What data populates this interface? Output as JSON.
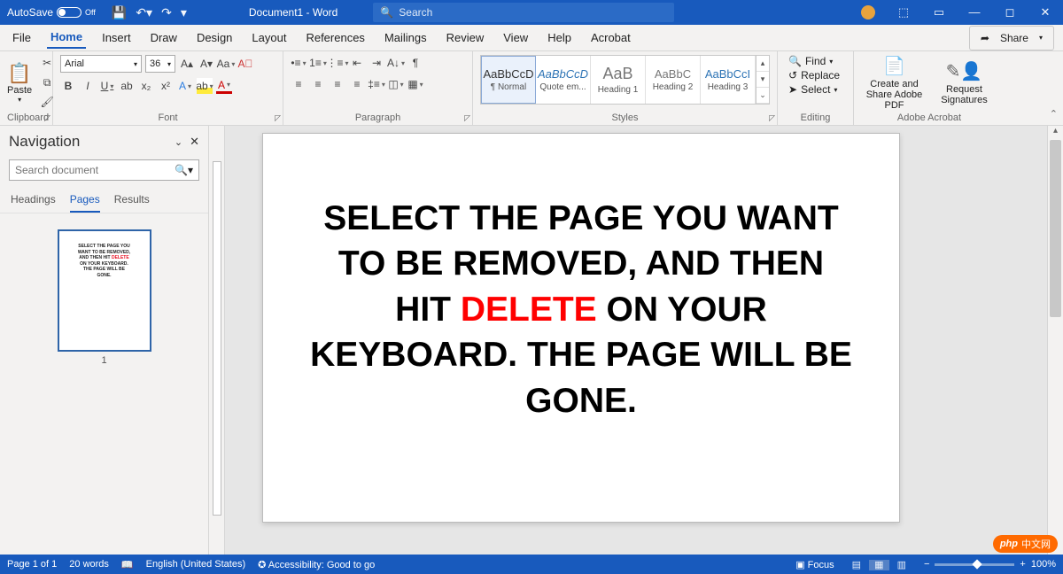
{
  "titlebar": {
    "autosave_label": "AutoSave",
    "autosave_state": "Off",
    "doc_title": "Document1 - Word",
    "search_placeholder": "Search"
  },
  "menutabs": [
    "File",
    "Home",
    "Insert",
    "Draw",
    "Design",
    "Layout",
    "References",
    "Mailings",
    "Review",
    "View",
    "Help",
    "Acrobat"
  ],
  "menu_active": "Home",
  "share_label": "Share",
  "ribbon": {
    "clipboard": {
      "paste": "Paste",
      "label": "Clipboard"
    },
    "font": {
      "name": "Arial",
      "size": "36",
      "label": "Font"
    },
    "paragraph": {
      "label": "Paragraph"
    },
    "styles": {
      "label": "Styles",
      "items": [
        {
          "preview": "AaBbCcD",
          "name": "¶ Normal"
        },
        {
          "preview": "AaBbCcD",
          "name": "Quote em..."
        },
        {
          "preview": "AaB",
          "name": "Heading 1"
        },
        {
          "preview": "AaBbC",
          "name": "Heading 2"
        },
        {
          "preview": "AaBbCcI",
          "name": "Heading 3"
        }
      ]
    },
    "editing": {
      "find": "Find",
      "replace": "Replace",
      "select": "Select",
      "label": "Editing"
    },
    "adobe": {
      "btn1": "Create and Share Adobe PDF",
      "btn2": "Request Signatures",
      "label": "Adobe Acrobat"
    }
  },
  "nav": {
    "title": "Navigation",
    "search_placeholder": "Search document",
    "tabs": [
      "Headings",
      "Pages",
      "Results"
    ],
    "tab_active": "Pages",
    "thumb_text1": "SELECT THE PAGE YOU",
    "thumb_text2": "WANT TO BE REMOVED,",
    "thumb_text3a": "AND THEN HIT ",
    "thumb_text3b": "DELETE",
    "thumb_text4": "ON YOUR KEYBOARD.",
    "thumb_text5": "THE PAGE WILL BE",
    "thumb_text6": "GONE.",
    "thumb_num": "1"
  },
  "document": {
    "line1": "SELECT THE PAGE YOU WANT TO BE REMOVED, AND THEN HIT ",
    "delete": "DELETE",
    "line2": " ON YOUR KEYBOARD. THE PAGE WILL BE GONE."
  },
  "status": {
    "page": "Page 1 of 1",
    "words": "20 words",
    "lang": "English (United States)",
    "access": "Accessibility: Good to go",
    "focus": "Focus",
    "zoom": "100%"
  },
  "watermark": "中文网"
}
